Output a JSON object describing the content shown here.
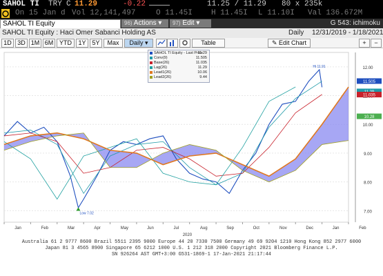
{
  "quote": {
    "ticker": "SAHOL TI",
    "currency": "TRY",
    "flag": "C",
    "last": "11.29",
    "change": "-0.22",
    "bid_ask": "11.25 / 11.29",
    "size": "80 x 235k",
    "date": "On 15 Jan d",
    "volume": "Vol 12,141,497",
    "open": "O 11.45I",
    "high": "H 11.45I",
    "low": "L 11.10I",
    "value": "Val 136.672M"
  },
  "bar3": {
    "security": "SAHOL TI Equity",
    "actions_num": "96)",
    "actions": "Actions",
    "edit_num": "97)",
    "edit": "Edit",
    "function": "G 543: ichimoku"
  },
  "bar4": {
    "title": "SAHOL TI Equity : Haci Omer Sabanci Holding AS",
    "period": "Daily",
    "range": "12/31/2019 - 1/18/2021"
  },
  "toolbar": {
    "ranges": [
      "1D",
      "3D",
      "1M",
      "6M",
      "YTD",
      "1Y",
      "5Y",
      "Max"
    ],
    "daily": "Daily",
    "table": "Table",
    "edit_chart": "Edit Chart"
  },
  "legend": {
    "items": [
      {
        "label": "SAHOL TI Equity - Last Price",
        "value": "11.29",
        "color": "#1f4fbf"
      },
      {
        "label": "Conv(9)",
        "value": "11.505",
        "color": "#1f9aa8"
      },
      {
        "label": "Base(26)",
        "value": "11.035",
        "color": "#c8202a"
      },
      {
        "label": "Lag(26)",
        "value": "11.29",
        "color": "#1fa0a0"
      },
      {
        "label": "Lead1(26)",
        "value": "10.06",
        "color": "#e07820"
      },
      {
        "label": "Lead2(26)",
        "value": "9.44",
        "color": "#a0a020"
      }
    ]
  },
  "annotations": {
    "high": "Hi 11.91",
    "low": "Low 7.02"
  },
  "chart_data": {
    "type": "line",
    "x_labels": [
      "Jan",
      "Feb",
      "Mar",
      "Apr",
      "May",
      "Jun",
      "Jul",
      "Aug",
      "Sep",
      "Oct",
      "Nov",
      "Dec",
      "Jan",
      "Feb"
    ],
    "year_label": "2020",
    "y_ticks": [
      "12.00",
      "11.00",
      "10.00",
      "9.00",
      "8.00",
      "7.00"
    ],
    "ylim": [
      6.6,
      12.5
    ],
    "price_tags": [
      {
        "text": "11.505",
        "value": 11.505,
        "color": "#1f4fbf"
      },
      {
        "text": "11.29",
        "value": 11.29,
        "color": "#1f9aa8"
      },
      {
        "text": "11.035",
        "value": 11.035,
        "color": "#c8202a"
      },
      {
        "text": "10.28",
        "value": 10.28,
        "color": "#4caf50"
      }
    ],
    "series": [
      {
        "name": "SAHOL TI Equity - Last Price",
        "x": [
          0,
          0.5,
          1,
          1.5,
          2,
          2.5,
          2.8,
          3,
          3.5,
          4,
          4.5,
          5,
          5.5,
          6,
          6.5,
          7,
          7.5,
          8,
          8.5,
          9,
          9.5,
          10,
          10.5,
          11,
          11.5,
          11.9,
          12
        ],
        "values": [
          9.6,
          10.1,
          9.7,
          9.9,
          9.4,
          8.2,
          7.1,
          7.4,
          8.2,
          9.1,
          9.4,
          9.3,
          9.5,
          9.6,
          8.8,
          8.3,
          8.1,
          8.0,
          7.6,
          8.4,
          9.0,
          10.0,
          10.7,
          10.8,
          11.5,
          11.9,
          11.29
        ]
      },
      {
        "name": "Conv(9)",
        "x": [
          0,
          1,
          2,
          3,
          4,
          5,
          6,
          7,
          8,
          9,
          10,
          11,
          12
        ],
        "values": [
          9.7,
          9.8,
          9.3,
          7.6,
          8.9,
          9.3,
          9.4,
          8.5,
          7.9,
          8.3,
          9.9,
          10.9,
          11.5
        ]
      },
      {
        "name": "Base(26)",
        "x": [
          0,
          1,
          2,
          3,
          4,
          5,
          6,
          7,
          8,
          9,
          10,
          11,
          12
        ],
        "values": [
          9.6,
          9.7,
          9.4,
          8.3,
          8.5,
          9.1,
          9.2,
          8.8,
          8.2,
          8.3,
          9.2,
          10.4,
          11.04
        ]
      },
      {
        "name": "Lag(26)",
        "x": [
          0,
          1,
          2,
          3,
          4,
          5,
          6,
          7,
          8,
          9,
          10,
          11
        ],
        "values": [
          9.4,
          8.8,
          7.4,
          8.9,
          9.2,
          9.5,
          8.3,
          8.0,
          7.9,
          9.2,
          10.8,
          11.3
        ]
      },
      {
        "name": "Lead1(26)",
        "x": [
          0,
          1,
          2,
          3,
          4,
          5,
          6,
          7,
          8,
          9,
          10,
          11,
          12,
          13
        ],
        "values": [
          9.3,
          9.6,
          9.7,
          9.5,
          9.1,
          9.0,
          8.6,
          8.9,
          9.0,
          8.6,
          8.2,
          8.8,
          10.0,
          11.3
        ]
      },
      {
        "name": "Lead2(26)",
        "x": [
          0,
          1,
          2,
          3,
          4,
          5,
          6,
          7,
          8,
          9,
          10,
          11,
          12,
          13
        ],
        "values": [
          9.1,
          9.4,
          9.6,
          9.7,
          8.5,
          8.5,
          9.0,
          9.3,
          9.1,
          8.4,
          8.0,
          8.4,
          9.3,
          9.44
        ]
      }
    ]
  },
  "footer": {
    "line1": "Australia 61 2 9777 8600  Brazil 5511 2395 9000  Europe 44 20 7330 7500  Germany 49 69 9204 1210  Hong Kong 852 2977 6000",
    "line2": "Japan 81 3 4565 8900       Singapore 65 6212 1000       U.S. 1 212 318 2000      Copyright 2021 Bloomberg Finance L.P.",
    "line3": "SN 926264 AST  GMT+3:00 G531-1869-1 17-Jan-2021 21:17:44"
  }
}
